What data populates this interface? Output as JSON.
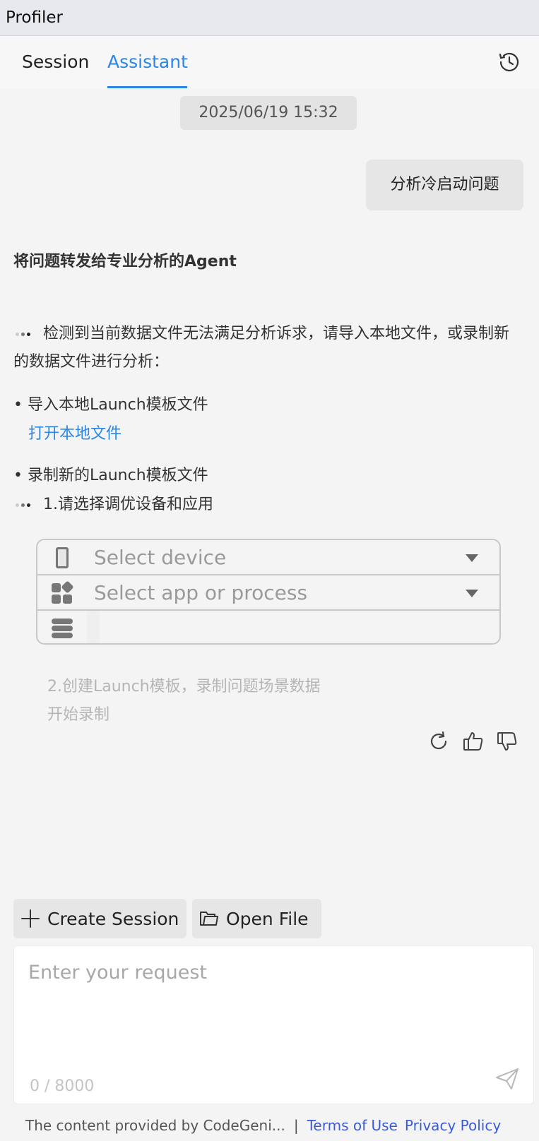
{
  "window": {
    "title": "Profiler"
  },
  "tabs": [
    {
      "label": "Session",
      "active": false
    },
    {
      "label": "Assistant",
      "active": true
    }
  ],
  "chat": {
    "timestamp": "2025/06/19 15:32",
    "user_message": "分析冷启动问题",
    "agent_title": "将问题转发给专业分析的Agent",
    "detect_message": "检测到当前数据文件无法满足分析诉求，请导入本地文件，或录制新的数据文件进行分析：",
    "option_import": "• 导入本地Launch模板文件",
    "open_local_link": "打开本地文件",
    "option_record": "• 录制新的Launch模板文件",
    "step1": "1.请选择调优设备和应用",
    "device_select": {
      "placeholder": "Select device"
    },
    "app_select": {
      "placeholder": "Select app or process"
    },
    "step2_line1": "2.创建Launch模板，录制问题场景数据",
    "step2_line2": "开始录制"
  },
  "actions": {
    "create_session": "Create Session",
    "open_file": "Open File"
  },
  "input": {
    "placeholder": "Enter your request",
    "counter": "0 / 8000"
  },
  "footer": {
    "disclaimer": "The content provided by CodeGeni...",
    "separator": "|",
    "terms": "Terms of Use",
    "privacy": "Privacy Policy"
  },
  "icons": {
    "history": "history-clock-icon",
    "device": "phone-icon",
    "app": "apps-grid-icon",
    "process": "stack-icon",
    "regenerate": "refresh-icon",
    "like": "thumbs-up-icon",
    "dislike": "thumbs-down-icon",
    "add": "plus-icon",
    "folder": "folder-icon",
    "send": "send-icon"
  },
  "colors": {
    "accent": "#2a86e8",
    "link_footer": "#3b5bd6",
    "background": "#f4f4f4"
  }
}
